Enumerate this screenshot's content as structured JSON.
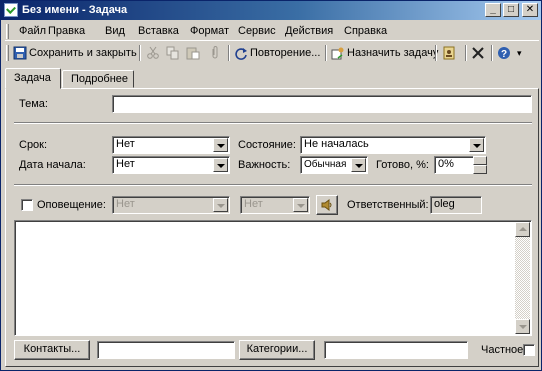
{
  "window": {
    "title": "Без имени - Задача",
    "minimize": "_",
    "maximize": "□",
    "close": "✕"
  },
  "menu": [
    {
      "label": "Файл"
    },
    {
      "label": "Правка"
    },
    {
      "label": "Вид"
    },
    {
      "label": "Вставка"
    },
    {
      "label": "Формат"
    },
    {
      "label": "Сервис"
    },
    {
      "label": "Действия"
    },
    {
      "label": "Справка"
    }
  ],
  "toolbar": {
    "save_close_label": "Сохранить и закрыть",
    "cut_icon": "scissors-icon",
    "copy_icon": "copy-icon",
    "paste_icon": "paste-icon",
    "attach_icon": "paperclip-icon",
    "recurrence_label": "Повторение...",
    "assign_task_label": "Назначить задачу",
    "delete_icon": "delete-x-icon",
    "help_icon": "help-icon"
  },
  "tabs": [
    {
      "label": "Задача",
      "active": true
    },
    {
      "label": "Подробнее",
      "active": false
    }
  ],
  "form": {
    "subject_label": "Тема:",
    "subject_value": "",
    "due_label": "Срок:",
    "due_value": "Нет",
    "start_label": "Дата начала:",
    "start_value": "Нет",
    "status_label": "Состояние:",
    "status_value": "Не началась",
    "priority_label": "Важность:",
    "priority_value": "Обычная",
    "complete_label": "Готово, %:",
    "complete_value": "0%",
    "reminder_label": "Оповещение:",
    "reminder_date": "Нет",
    "reminder_time": "Нет",
    "owner_label": "Ответственный:",
    "owner_value": "oleg",
    "notes_value": ""
  },
  "footer": {
    "contacts_button": "Контакты...",
    "contacts_value": "",
    "categories_button": "Категории...",
    "categories_value": "",
    "private_label": "Частное"
  }
}
